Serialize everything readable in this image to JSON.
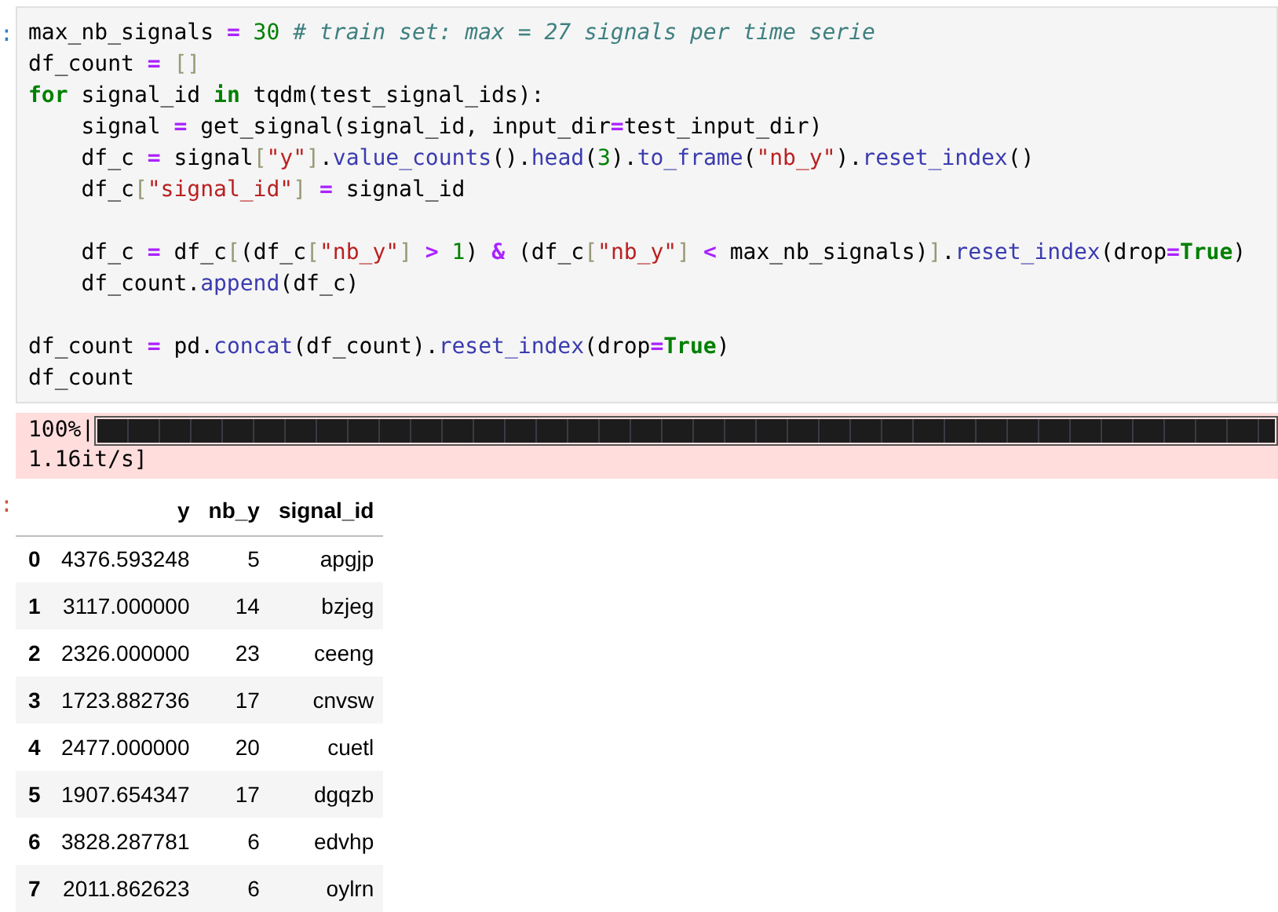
{
  "input_prompt": ":",
  "code": {
    "lines": [
      {
        "kind": "code",
        "tokens": [
          {
            "kind": "plain",
            "text": "max_nb_signals "
          },
          {
            "kind": "op",
            "text": "="
          },
          {
            "kind": "num",
            "text": " 30"
          },
          {
            "kind": "comment",
            "text": " # train set: max = 27 signals per time serie"
          }
        ]
      },
      {
        "kind": "code",
        "tokens": [
          {
            "kind": "plain",
            "text": "df_count "
          },
          {
            "kind": "op",
            "text": "="
          },
          {
            "kind": "punct",
            "text": " []"
          }
        ]
      },
      {
        "kind": "code",
        "tokens": [
          {
            "kind": "kw",
            "text": "for"
          },
          {
            "kind": "plain",
            "text": " signal_id "
          },
          {
            "kind": "kw",
            "text": "in"
          },
          {
            "kind": "plain",
            "text": " tqdm(test_signal_ids):"
          }
        ]
      },
      {
        "kind": "code",
        "tokens": [
          {
            "kind": "plain",
            "text": "    signal "
          },
          {
            "kind": "op",
            "text": "="
          },
          {
            "kind": "plain",
            "text": " get_signal(signal_id, input_dir"
          },
          {
            "kind": "op",
            "text": "="
          },
          {
            "kind": "plain",
            "text": "test_input_dir)"
          }
        ]
      },
      {
        "kind": "code",
        "tokens": [
          {
            "kind": "plain",
            "text": "    df_c "
          },
          {
            "kind": "op",
            "text": "="
          },
          {
            "kind": "plain",
            "text": " signal"
          },
          {
            "kind": "punct",
            "text": "["
          },
          {
            "kind": "str",
            "text": "\"y\""
          },
          {
            "kind": "punct",
            "text": "]"
          },
          {
            "kind": "plain",
            "text": "."
          },
          {
            "kind": "call",
            "text": "value_counts"
          },
          {
            "kind": "plain",
            "text": "()."
          },
          {
            "kind": "call",
            "text": "head"
          },
          {
            "kind": "plain",
            "text": "("
          },
          {
            "kind": "num",
            "text": "3"
          },
          {
            "kind": "plain",
            "text": ")."
          },
          {
            "kind": "call",
            "text": "to_frame"
          },
          {
            "kind": "plain",
            "text": "("
          },
          {
            "kind": "str",
            "text": "\"nb_y\""
          },
          {
            "kind": "plain",
            "text": ")."
          },
          {
            "kind": "call",
            "text": "reset_index"
          },
          {
            "kind": "plain",
            "text": "()"
          }
        ]
      },
      {
        "kind": "code",
        "tokens": [
          {
            "kind": "plain",
            "text": "    df_c"
          },
          {
            "kind": "punct",
            "text": "["
          },
          {
            "kind": "str",
            "text": "\"signal_id\""
          },
          {
            "kind": "punct",
            "text": "]"
          },
          {
            "kind": "op",
            "text": " ="
          },
          {
            "kind": "plain",
            "text": " signal_id"
          }
        ]
      },
      {
        "kind": "blank"
      },
      {
        "kind": "code",
        "tokens": [
          {
            "kind": "plain",
            "text": "    df_c "
          },
          {
            "kind": "op",
            "text": "="
          },
          {
            "kind": "plain",
            "text": " df_c"
          },
          {
            "kind": "punct",
            "text": "["
          },
          {
            "kind": "plain",
            "text": "(df_c"
          },
          {
            "kind": "punct",
            "text": "["
          },
          {
            "kind": "str",
            "text": "\"nb_y\""
          },
          {
            "kind": "punct",
            "text": "]"
          },
          {
            "kind": "op",
            "text": " >"
          },
          {
            "kind": "num",
            "text": " 1"
          },
          {
            "kind": "plain",
            "text": ") "
          },
          {
            "kind": "op",
            "text": "&"
          },
          {
            "kind": "plain",
            "text": " (df_c"
          },
          {
            "kind": "punct",
            "text": "["
          },
          {
            "kind": "str",
            "text": "\"nb_y\""
          },
          {
            "kind": "punct",
            "text": "]"
          },
          {
            "kind": "op",
            "text": " <"
          },
          {
            "kind": "plain",
            "text": " max_nb_signals)"
          },
          {
            "kind": "punct",
            "text": "]"
          },
          {
            "kind": "plain",
            "text": "."
          },
          {
            "kind": "call",
            "text": "reset_index"
          },
          {
            "kind": "plain",
            "text": "(drop"
          },
          {
            "kind": "op",
            "text": "="
          },
          {
            "kind": "kw",
            "text": "True"
          },
          {
            "kind": "plain",
            "text": ")"
          }
        ]
      },
      {
        "kind": "code",
        "tokens": [
          {
            "kind": "plain",
            "text": "    df_count."
          },
          {
            "kind": "call",
            "text": "append"
          },
          {
            "kind": "plain",
            "text": "(df_c)"
          }
        ]
      },
      {
        "kind": "blank"
      },
      {
        "kind": "code",
        "tokens": [
          {
            "kind": "plain",
            "text": "df_count "
          },
          {
            "kind": "op",
            "text": "="
          },
          {
            "kind": "plain",
            "text": " pd."
          },
          {
            "kind": "call",
            "text": "concat"
          },
          {
            "kind": "plain",
            "text": "(df_count)."
          },
          {
            "kind": "call",
            "text": "reset_index"
          },
          {
            "kind": "plain",
            "text": "(drop"
          },
          {
            "kind": "op",
            "text": "="
          },
          {
            "kind": "kw",
            "text": "True"
          },
          {
            "kind": "plain",
            "text": ")"
          }
        ]
      },
      {
        "kind": "code",
        "tokens": [
          {
            "kind": "plain",
            "text": "df_count"
          }
        ]
      }
    ]
  },
  "progress": {
    "percent": "100%|",
    "level": 1,
    "rate": "1.16it/s]"
  },
  "output_prompt": ":",
  "table": {
    "columns": [
      "y",
      "nb_y",
      "signal_id"
    ],
    "rows": [
      {
        "index": "0",
        "cells": [
          "4376.593248",
          "5",
          "apgjp"
        ]
      },
      {
        "index": "1",
        "cells": [
          "3117.000000",
          "14",
          "bzjeg"
        ]
      },
      {
        "index": "2",
        "cells": [
          "2326.000000",
          "23",
          "ceeng"
        ]
      },
      {
        "index": "3",
        "cells": [
          "1723.882736",
          "17",
          "cnvsw"
        ]
      },
      {
        "index": "4",
        "cells": [
          "2477.000000",
          "20",
          "cuetl"
        ]
      },
      {
        "index": "5",
        "cells": [
          "1907.654347",
          "17",
          "dgqzb"
        ]
      },
      {
        "index": "6",
        "cells": [
          "3828.287781",
          "6",
          "edvhp"
        ]
      },
      {
        "index": "7",
        "cells": [
          "2011.862623",
          "6",
          "oylrn"
        ]
      }
    ]
  }
}
